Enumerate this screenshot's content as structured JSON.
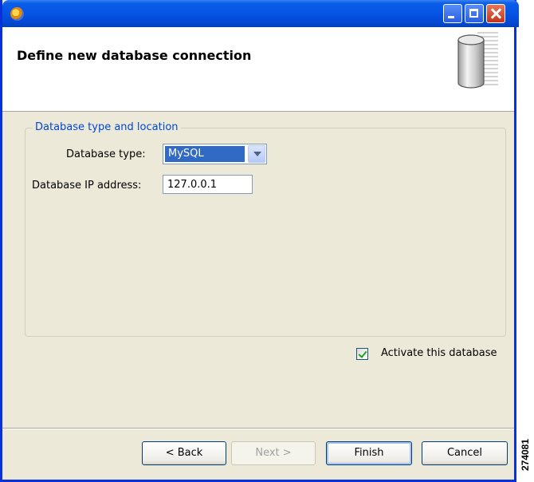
{
  "window": {
    "icon": "app-logo-icon",
    "controls": [
      "minimize-icon",
      "maximize-icon",
      "close-icon"
    ]
  },
  "header": {
    "title": "Define new database connection",
    "icon": "database-cylinder-icon"
  },
  "group": {
    "title": "Database type and location",
    "type_label": "Database type:",
    "type_value": "MySQL",
    "ip_label": "Database IP address:",
    "ip_value": "127.0.0.1"
  },
  "activate": {
    "label": "Activate this database",
    "checked": true
  },
  "buttons": {
    "back": "< Back",
    "next": "Next >",
    "finish": "Finish",
    "cancel": "Cancel"
  },
  "figure_number": "274081",
  "colors": {
    "titlebar": "#0554e3",
    "dialog_bg": "#ece9d8",
    "group_title": "#0046d5",
    "selection": "#316ac5"
  }
}
